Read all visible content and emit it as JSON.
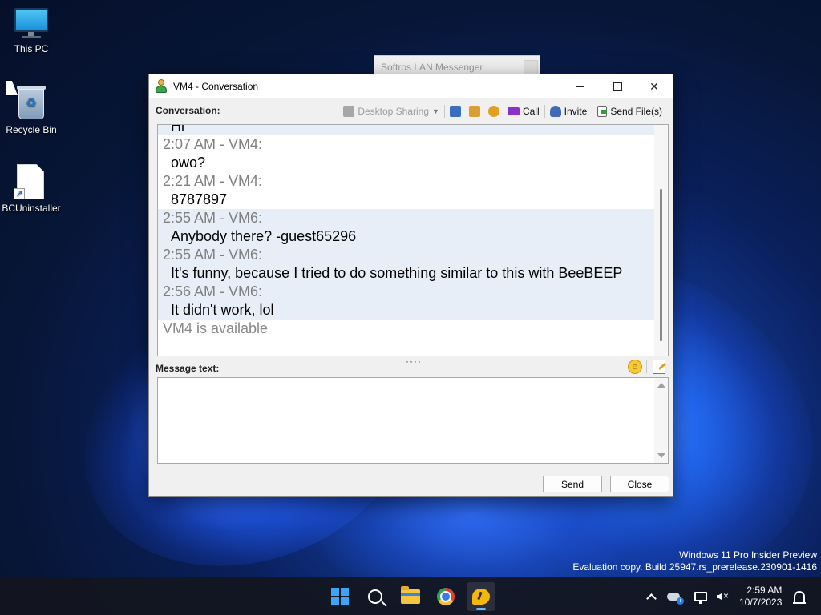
{
  "desktop": {
    "icons": [
      {
        "label": "This PC",
        "icon": "computer-icon"
      },
      {
        "label": "Recycle Bin",
        "icon": "recycle-bin-icon"
      },
      {
        "label": "BCUninstaller",
        "icon": "shortcut-file-icon"
      }
    ],
    "watermark_line1": "Windows 11 Pro Insider Preview",
    "watermark_line2": "Evaluation copy. Build 25947.rs_prerelease.230901-1416"
  },
  "background_window": {
    "title": "Softros LAN Messenger"
  },
  "window": {
    "title": "VM4 - Conversation",
    "conversation_label": "Conversation:",
    "toolbar": {
      "desktop_sharing": "Desktop Sharing",
      "call": "Call",
      "invite": "Invite",
      "send_files": "Send File(s)"
    },
    "messages": [
      {
        "header": "Hi",
        "body": "",
        "alt": true,
        "partial": true
      },
      {
        "header": "2:07 AM - VM4:",
        "body": "owo?",
        "alt": false
      },
      {
        "header": "2:21 AM - VM4:",
        "body": "8787897",
        "alt": false
      },
      {
        "header": "2:55 AM - VM6:",
        "body": "Anybody there? -guest65296",
        "alt": true
      },
      {
        "header": "2:55 AM - VM6:",
        "body": "It's funny, because I tried to do something similar to this with BeeBEEP",
        "alt": true
      },
      {
        "header": "2:56 AM - VM6:",
        "body": "It didn't work, lol",
        "alt": true
      }
    ],
    "status_line": "VM4 is available",
    "message_text_label": "Message text:",
    "message_input_value": "",
    "send_label": "Send",
    "close_label": "Close"
  },
  "taskbar": {
    "apps": [
      {
        "name": "start",
        "icon": "windows-logo-icon"
      },
      {
        "name": "search",
        "icon": "search-icon"
      },
      {
        "name": "file-explorer",
        "icon": "folder-icon"
      },
      {
        "name": "chrome",
        "icon": "chrome-icon"
      },
      {
        "name": "softros-messenger",
        "icon": "messenger-icon",
        "active": true
      }
    ],
    "clock_time": "2:59 AM",
    "clock_date": "10/7/2023"
  }
}
